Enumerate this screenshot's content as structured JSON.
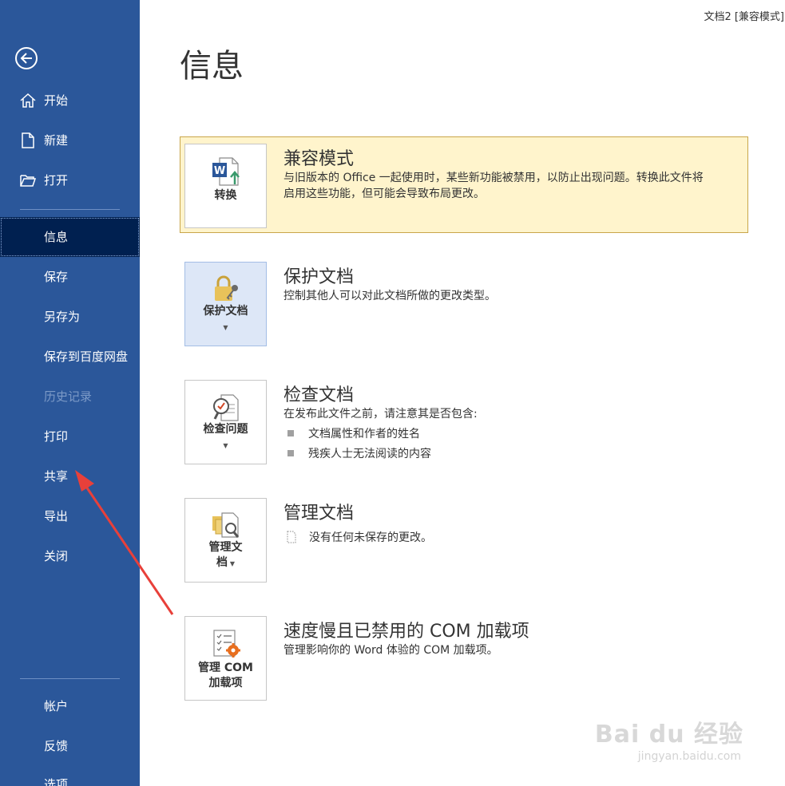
{
  "window": {
    "title": "文档2 [兼容模式]"
  },
  "sidebar": {
    "top_items": [
      {
        "label": "开始",
        "icon": "home-icon"
      },
      {
        "label": "新建",
        "icon": "new-document-icon"
      },
      {
        "label": "打开",
        "icon": "folder-open-icon"
      }
    ],
    "items": [
      {
        "label": "信息",
        "active": true
      },
      {
        "label": "保存"
      },
      {
        "label": "另存为"
      },
      {
        "label": "保存到百度网盘"
      },
      {
        "label": "历史记录",
        "disabled": true
      },
      {
        "label": "打印"
      },
      {
        "label": "共享"
      },
      {
        "label": "导出"
      },
      {
        "label": "关闭"
      }
    ],
    "bottom_items": [
      {
        "label": "帐户"
      },
      {
        "label": "反馈"
      },
      {
        "label": "选项"
      }
    ]
  },
  "page": {
    "title": "信息"
  },
  "sections": {
    "compat": {
      "button_label": "转换",
      "title": "兼容模式",
      "desc_line1": "与旧版本的 Office 一起使用时，某些新功能被禁用，以防止出现问题。转换此文件将",
      "desc_line2": "启用这些功能，但可能会导致布局更改。"
    },
    "protect": {
      "button_label": "保护文档",
      "title": "保护文档",
      "desc": "控制其他人可以对此文档所做的更改类型。"
    },
    "inspect": {
      "button_label": "检查问题",
      "title": "检查文档",
      "desc": "在发布此文件之前，请注意其是否包含:",
      "bullets": [
        "文档属性和作者的姓名",
        "残疾人士无法阅读的内容"
      ]
    },
    "manage": {
      "button_line1": "管理文",
      "button_line2": "档",
      "title": "管理文档",
      "desc": "没有任何未保存的更改。"
    },
    "com": {
      "button_line1": "管理 COM",
      "button_line2": "加载项",
      "title": "速度慢且已禁用的 COM 加载项",
      "desc": "管理影响你的 Word 体验的 COM 加载项。"
    }
  },
  "watermark": {
    "brand": "Bai du 经验",
    "url": "jingyan.baidu.com"
  },
  "colors": {
    "sidebar": "#2b579a",
    "active": "#002050",
    "compat_bg": "#fff4cc",
    "arrow": "#e8403a"
  }
}
